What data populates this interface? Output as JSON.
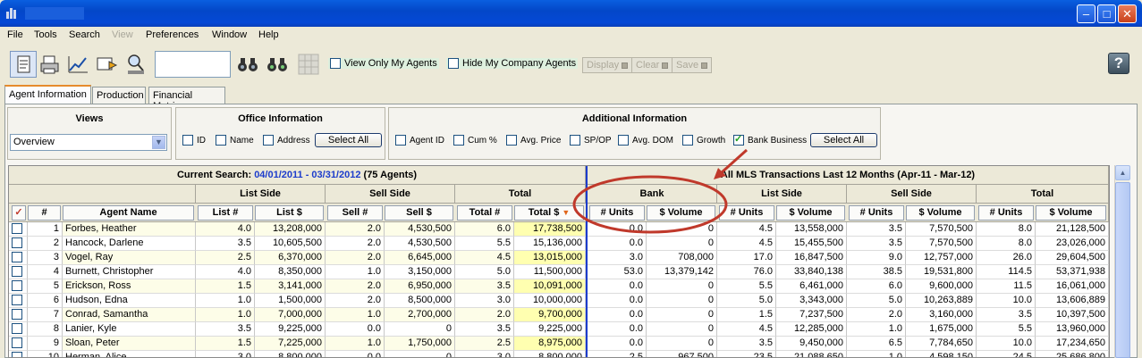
{
  "menu": [
    "File",
    "Tools",
    "Search",
    "View",
    "Preferences",
    "Window",
    "Help"
  ],
  "toolbar": {
    "view_only_my_agents": "View Only My Agents",
    "hide_my_company_agents": "Hide My Company Agents",
    "display": "Display",
    "clear": "Clear",
    "save": "Save",
    "help": "?",
    "search_value": ""
  },
  "tabs": [
    "Agent Information",
    "Production",
    "Financial Metrics"
  ],
  "views": {
    "title": "Views",
    "selected": "Overview"
  },
  "office": {
    "title": "Office Information",
    "options": [
      "ID",
      "Name",
      "Address"
    ],
    "select_all": "Select All"
  },
  "additional": {
    "title": "Additional Information",
    "options": [
      {
        "label": "Agent ID",
        "checked": false
      },
      {
        "label": "Cum %",
        "checked": false
      },
      {
        "label": "Avg. Price",
        "checked": false
      },
      {
        "label": "SP/OP",
        "checked": false
      },
      {
        "label": "Avg. DOM",
        "checked": false
      },
      {
        "label": "Growth",
        "checked": false
      },
      {
        "label": "Bank Business",
        "checked": true
      }
    ],
    "select_all": "Select All"
  },
  "grid": {
    "search_label": "Current Search: ",
    "search_range": "04/01/2011 - 03/31/2012",
    "search_count": " (75 Agents)",
    "mls_title": "All MLS Transactions Last 12 Months (Apr-11 - Mar-12)",
    "groups_left": [
      "List Side",
      "Sell Side",
      "Total"
    ],
    "groups_right": [
      "Bank",
      "List Side",
      "Sell Side",
      "Total"
    ],
    "cols": [
      "#",
      "Agent Name",
      "List #",
      "List $",
      "Sell #",
      "Sell $",
      "Total #",
      "Total $",
      "# Units",
      "$ Volume",
      "# Units",
      "$ Volume",
      "# Units",
      "$ Volume",
      "# Units",
      "$ Volume"
    ],
    "rows": [
      [
        "1",
        "Forbes, Heather",
        "4.0",
        "13,208,000",
        "2.0",
        "4,530,500",
        "6.0",
        "17,738,500",
        "0.0",
        "0",
        "4.5",
        "13,558,000",
        "3.5",
        "7,570,500",
        "8.0",
        "21,128,500"
      ],
      [
        "2",
        "Hancock, Darlene",
        "3.5",
        "10,605,500",
        "2.0",
        "4,530,500",
        "5.5",
        "15,136,000",
        "0.0",
        "0",
        "4.5",
        "15,455,500",
        "3.5",
        "7,570,500",
        "8.0",
        "23,026,000"
      ],
      [
        "3",
        "Vogel, Ray",
        "2.5",
        "6,370,000",
        "2.0",
        "6,645,000",
        "4.5",
        "13,015,000",
        "3.0",
        "708,000",
        "17.0",
        "16,847,500",
        "9.0",
        "12,757,000",
        "26.0",
        "29,604,500"
      ],
      [
        "4",
        "Burnett, Christopher",
        "4.0",
        "8,350,000",
        "1.0",
        "3,150,000",
        "5.0",
        "11,500,000",
        "53.0",
        "13,379,142",
        "76.0",
        "33,840,138",
        "38.5",
        "19,531,800",
        "114.5",
        "53,371,938"
      ],
      [
        "5",
        "Erickson, Ross",
        "1.5",
        "3,141,000",
        "2.0",
        "6,950,000",
        "3.5",
        "10,091,000",
        "0.0",
        "0",
        "5.5",
        "6,461,000",
        "6.0",
        "9,600,000",
        "11.5",
        "16,061,000"
      ],
      [
        "6",
        "Hudson, Edna",
        "1.0",
        "1,500,000",
        "2.0",
        "8,500,000",
        "3.0",
        "10,000,000",
        "0.0",
        "0",
        "5.0",
        "3,343,000",
        "5.0",
        "10,263,889",
        "10.0",
        "13,606,889"
      ],
      [
        "7",
        "Conrad, Samantha",
        "1.0",
        "7,000,000",
        "1.0",
        "2,700,000",
        "2.0",
        "9,700,000",
        "0.0",
        "0",
        "1.5",
        "7,237,500",
        "2.0",
        "3,160,000",
        "3.5",
        "10,397,500"
      ],
      [
        "8",
        "Lanier, Kyle",
        "3.5",
        "9,225,000",
        "0.0",
        "0",
        "3.5",
        "9,225,000",
        "0.0",
        "0",
        "4.5",
        "12,285,000",
        "1.0",
        "1,675,000",
        "5.5",
        "13,960,000"
      ],
      [
        "9",
        "Sloan, Peter",
        "1.5",
        "7,225,000",
        "1.0",
        "1,750,000",
        "2.5",
        "8,975,000",
        "0.0",
        "0",
        "3.5",
        "9,450,000",
        "6.5",
        "7,784,650",
        "10.0",
        "17,234,650"
      ],
      [
        "10",
        "Herman, Alice",
        "3.0",
        "8,800,000",
        "0.0",
        "0",
        "3.0",
        "8,800,000",
        "2.5",
        "967,500",
        "23.5",
        "21,088,650",
        "1.0",
        "4,598,150",
        "24.5",
        "25,686,800"
      ]
    ]
  },
  "colors": {
    "accent": "#1c3ccc",
    "highlight": "#ffffb0",
    "annotation": "#c0392b"
  }
}
